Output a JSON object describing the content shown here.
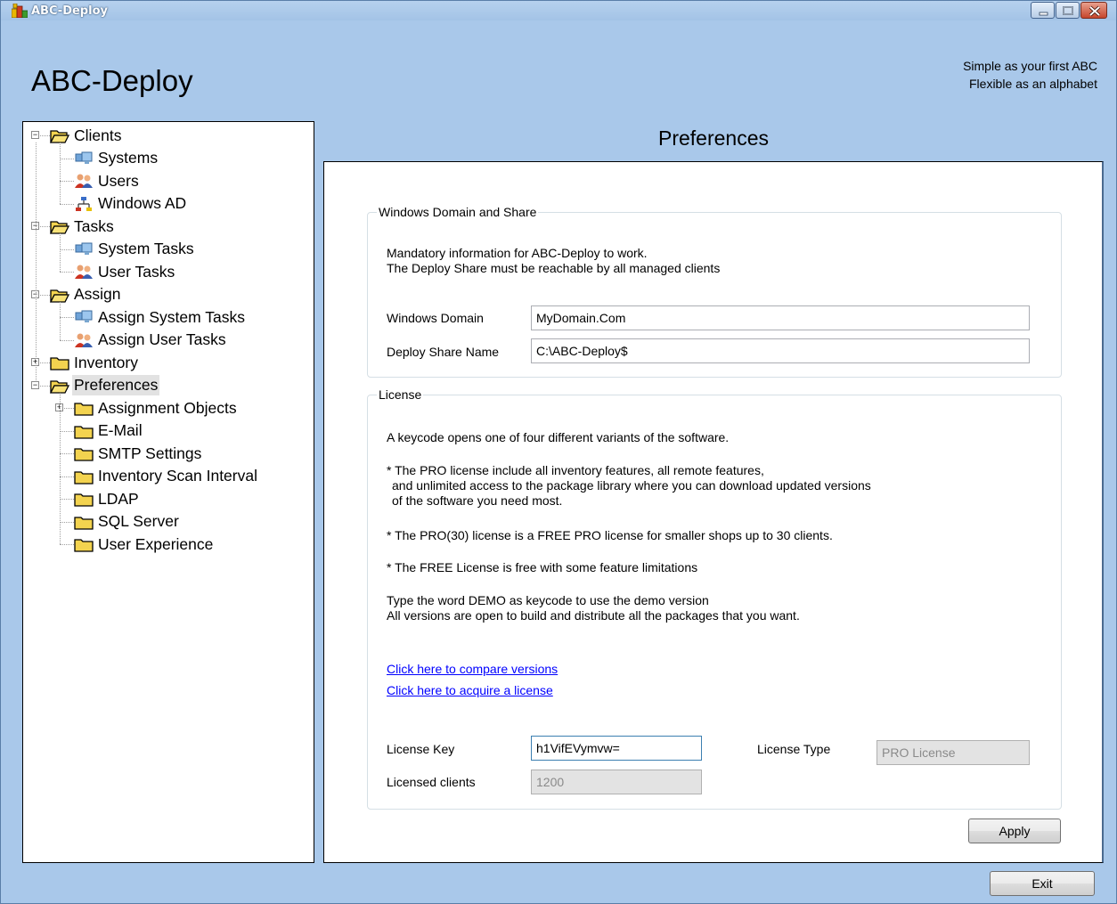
{
  "window": {
    "title": "ABC-Deploy",
    "app_title": "ABC-Deploy",
    "tagline": [
      "Simple as your first ABC",
      "Flexible as an alphabet"
    ]
  },
  "tree": [
    {
      "label": "Clients",
      "icon": "folder-open-icon",
      "level": 0,
      "expander": "minus"
    },
    {
      "label": "Systems",
      "icon": "computers-icon",
      "level": 1
    },
    {
      "label": "Users",
      "icon": "users-icon",
      "level": 1
    },
    {
      "label": "Windows AD",
      "icon": "network-tree-icon",
      "level": 1
    },
    {
      "label": "Tasks",
      "icon": "folder-open-icon",
      "level": 0,
      "expander": "minus"
    },
    {
      "label": "System Tasks",
      "icon": "computers-icon",
      "level": 1
    },
    {
      "label": "User Tasks",
      "icon": "users-icon",
      "level": 1
    },
    {
      "label": "Assign",
      "icon": "folder-open-icon",
      "level": 0,
      "expander": "minus"
    },
    {
      "label": "Assign System Tasks",
      "icon": "computers-icon",
      "level": 1
    },
    {
      "label": "Assign User Tasks",
      "icon": "users-icon",
      "level": 1
    },
    {
      "label": "Inventory",
      "icon": "folder-icon",
      "level": 0,
      "expander": "plus"
    },
    {
      "label": "Preferences",
      "icon": "folder-open-icon",
      "level": 0,
      "expander": "minus",
      "selected": true
    },
    {
      "label": "Assignment Objects",
      "icon": "folder-icon",
      "level": 1,
      "expander": "plus"
    },
    {
      "label": "E-Mail",
      "icon": "folder-icon",
      "level": 1
    },
    {
      "label": "SMTP Settings",
      "icon": "folder-icon",
      "level": 1
    },
    {
      "label": "Inventory Scan Interval",
      "icon": "folder-icon",
      "level": 1
    },
    {
      "label": "LDAP",
      "icon": "folder-icon",
      "level": 1
    },
    {
      "label": "SQL Server",
      "icon": "folder-icon",
      "level": 1
    },
    {
      "label": "User Experience",
      "icon": "folder-icon",
      "level": 1
    }
  ],
  "content": {
    "header": "Preferences",
    "domain_group": {
      "legend": "Windows Domain and Share",
      "desc_line1": "Mandatory information for ABC-Deploy to work.",
      "desc_line2": "The Deploy Share must be reachable by all managed clients",
      "domain_label": "Windows Domain",
      "domain_value": "MyDomain.Com",
      "share_label": "Deploy Share Name",
      "share_value": "C:\\ABC-Deploy$"
    },
    "license_group": {
      "legend": "License",
      "intro": "A keycode opens one of four different variants of the software.",
      "pro_line1": "* The PRO license include all inventory features, all remote features,",
      "pro_line2": "and unlimited access to the package library where you can download updated versions",
      "pro_line3": "of the software you need most.",
      "pro30": "*  The PRO(30) license is a FREE PRO license for smaller shops up to 30 clients.",
      "free": "*  The FREE License is free with some feature limitations",
      "demo_line1": "Type the word DEMO as keycode to use the demo version",
      "demo_line2": "All versions are open to build and distribute all the packages that you want.",
      "compare_link": "Click here to compare versions",
      "acquire_link": "Click here to acquire a license",
      "key_label": "License Key",
      "key_value": "h1VifEVymvw=",
      "type_label": "License Type",
      "type_value": "PRO License",
      "clients_label": "Licensed clients",
      "clients_value": "1200"
    },
    "apply_label": "Apply"
  },
  "footer": {
    "exit_label": "Exit"
  },
  "colors": {
    "chrome": "#a9c8ea",
    "link": "#0000ff",
    "selection": "#e2e2e2"
  }
}
